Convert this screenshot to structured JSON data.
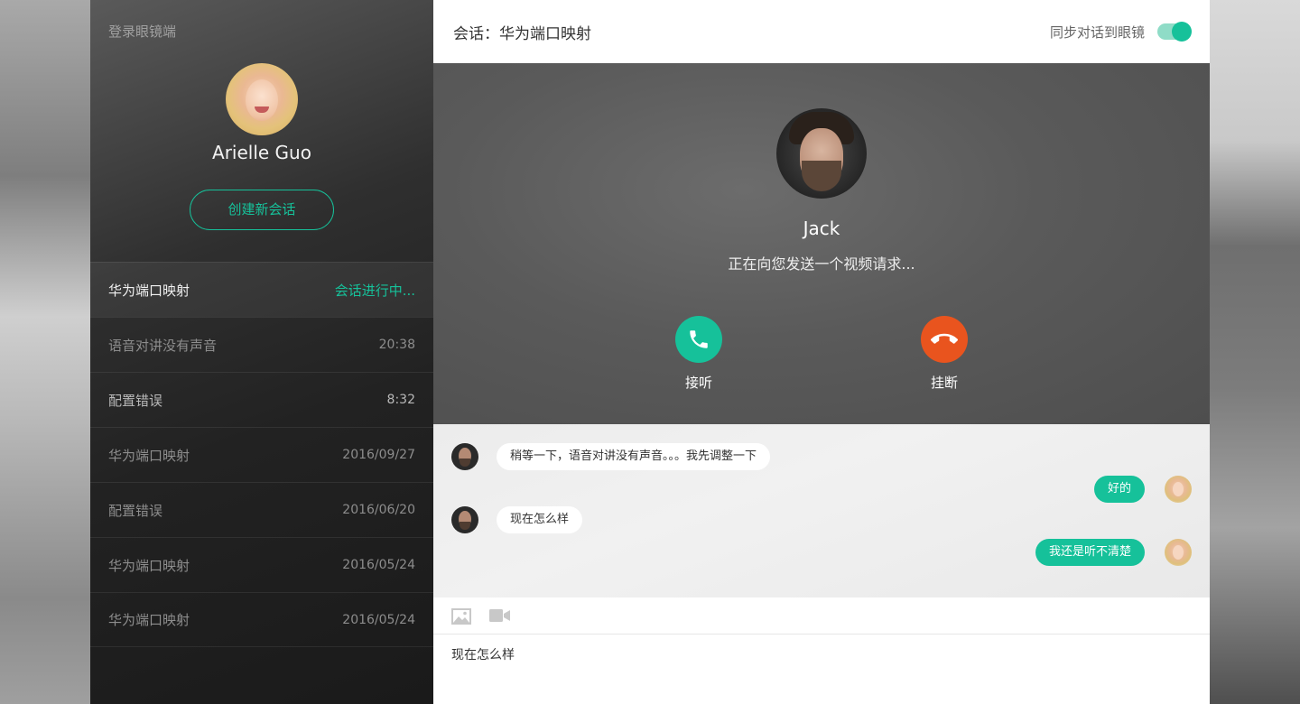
{
  "sidebar": {
    "login_label": "登录眼镜端",
    "profile_name": "Arielle Guo",
    "new_session_label": "创建新会话",
    "sessions": [
      {
        "name": "华为端口映射",
        "time": "会话进行中..."
      },
      {
        "name": "语音对讲没有声音",
        "time": "20:38"
      },
      {
        "name": "配置错误",
        "time": "8:32"
      },
      {
        "name": "华为端口映射",
        "time": "2016/09/27"
      },
      {
        "name": "配置错误",
        "time": "2016/06/20"
      },
      {
        "name": "华为端口映射",
        "time": "2016/05/24"
      },
      {
        "name": "华为端口映射",
        "time": "2016/05/24"
      }
    ]
  },
  "header": {
    "title": "会话：华为端口映射",
    "sync_label": "同步对话到眼镜",
    "sync_enabled": true
  },
  "call": {
    "caller_name": "Jack",
    "status": "正在向您发送一个视频请求...",
    "accept_label": "接听",
    "hangup_label": "挂断",
    "accept_icon": "phone-icon",
    "hangup_icon": "phone-hangup-icon"
  },
  "messages": [
    {
      "from": "Jack",
      "side": "left",
      "text": "稍等一下，语音对讲没有声音。。。我先调整一下"
    },
    {
      "from": "Arielle Guo",
      "side": "right",
      "text": "好的"
    },
    {
      "from": "Jack",
      "side": "left",
      "text": "现在怎么样"
    },
    {
      "from": "Arielle Guo",
      "side": "right",
      "text": "我还是听不清楚"
    }
  ],
  "composer": {
    "tools": [
      "image-icon",
      "video-icon"
    ],
    "value": "现在怎么样"
  },
  "colors": {
    "accent": "#16c19a",
    "hangup": "#e9541e"
  }
}
